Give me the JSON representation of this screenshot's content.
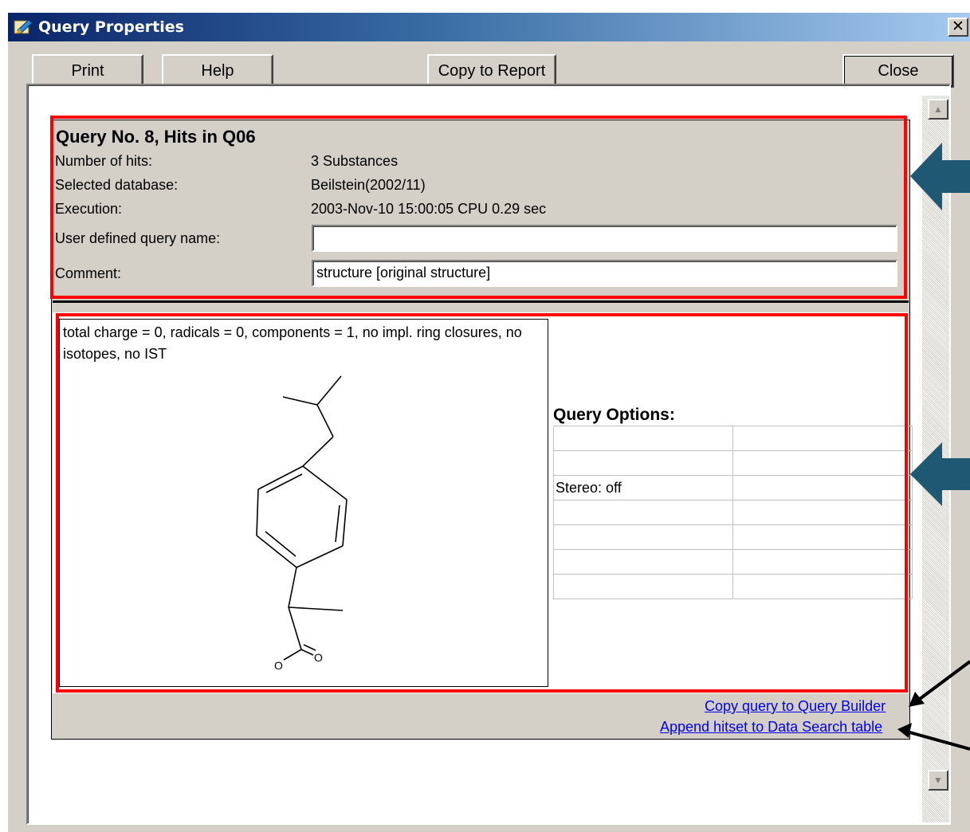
{
  "window": {
    "title": "Query Properties",
    "close_glyph": "✕"
  },
  "toolbar": {
    "print_label": "Print",
    "help_label": "Help",
    "copy_to_report_label": "Copy to Report",
    "close_label": "Close"
  },
  "query": {
    "heading": "Query No. 8, Hits in Q06",
    "fields": [
      {
        "label": "Number of hits:",
        "value": "3 Substances"
      },
      {
        "label": "Selected database:",
        "value": "Beilstein(2002/11)"
      },
      {
        "label": "Execution:",
        "value": "2003-Nov-10 15:00:05 CPU 0.29 sec"
      }
    ],
    "user_name_label": "User defined query name:",
    "user_name_value": "",
    "comment_label": "Comment:",
    "comment_value": "structure [original structure]"
  },
  "structure": {
    "description": "total charge = 0, radicals = 0, components = 1, no impl. ring closures, no isotopes, no IST",
    "atom_o1": "O",
    "atom_o2": "O"
  },
  "options": {
    "heading": "Query Options:",
    "rows": [
      [
        "",
        ""
      ],
      [
        "",
        ""
      ],
      [
        "Stereo: off",
        ""
      ],
      [
        "",
        ""
      ],
      [
        "",
        ""
      ],
      [
        "",
        ""
      ],
      [
        "",
        ""
      ]
    ]
  },
  "links": {
    "copy_query": "Copy query to Query Builder",
    "append_hitset": "Append hitset to Data Search table"
  },
  "scrollbar": {
    "up_glyph": "▲",
    "down_glyph": "▼"
  },
  "colors": {
    "annotation_red": "#ff0000",
    "annotation_arrow": "#1f5873",
    "title_gradient_start": "#0a246a",
    "link": "#0000ee"
  }
}
